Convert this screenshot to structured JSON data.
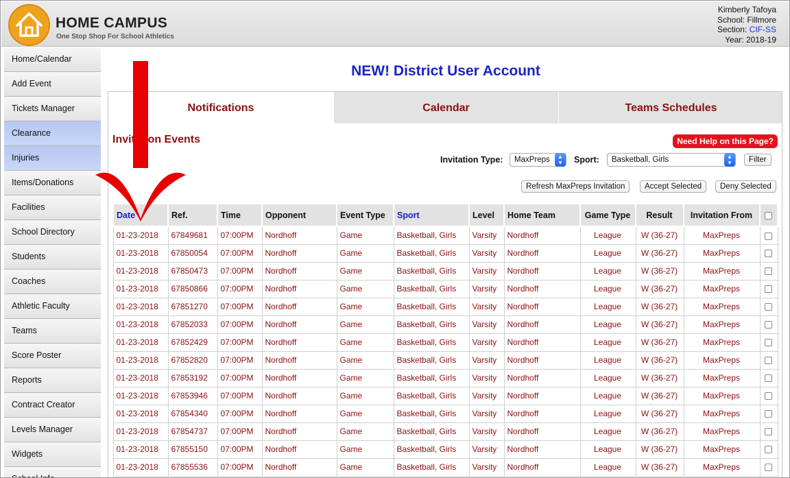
{
  "header": {
    "brand_title": "HOME CAMPUS",
    "brand_tagline": "One Stop Shop For School Athletics",
    "user": {
      "name": "Kimberly Tafoya",
      "school": "School: Fillmore",
      "section_label": "Section: ",
      "section_value": "CIF-SS",
      "year": "Year: 2018-19"
    }
  },
  "sidebar": {
    "items": [
      {
        "label": "Home/Calendar"
      },
      {
        "label": "Add Event"
      },
      {
        "label": "Tickets Manager"
      },
      {
        "label": "Clearance"
      },
      {
        "label": "Injuries"
      },
      {
        "label": "Items/Donations"
      },
      {
        "label": "Facilities"
      },
      {
        "label": "School Directory"
      },
      {
        "label": "Students"
      },
      {
        "label": "Coaches"
      },
      {
        "label": "Athletic Faculty"
      },
      {
        "label": "Teams"
      },
      {
        "label": "Score Poster"
      },
      {
        "label": "Reports"
      },
      {
        "label": "Contract Creator"
      },
      {
        "label": "Levels Manager"
      },
      {
        "label": "Widgets"
      },
      {
        "label": "School Info"
      }
    ]
  },
  "page_title": "NEW! District User Account",
  "tabs": [
    {
      "label": "Notifications"
    },
    {
      "label": "Calendar"
    },
    {
      "label": "Teams Schedules"
    }
  ],
  "section_title": "Invitation Events",
  "help_button": "Need Help on this Page?",
  "filters": {
    "invitation_type_label": "Invitation Type:",
    "invitation_type_value": "MaxPreps",
    "sport_label": "Sport:",
    "sport_value": "Basketball, Girls",
    "filter_button": "Filter"
  },
  "actions": {
    "refresh": "Refresh MaxPreps Invitation",
    "accept": "Accept Selected",
    "deny": "Deny Selected"
  },
  "table": {
    "columns": [
      "Date",
      "Ref.",
      "Time",
      "Opponent",
      "Event Type",
      "Sport",
      "Level",
      "Home Team",
      "Game Type",
      "Result",
      "Invitation From"
    ],
    "rows": [
      [
        "01-23-2018",
        "67849681",
        "07:00PM",
        "Nordhoff",
        "Game",
        "Basketball, Girls",
        "Varsity",
        "Nordhoff",
        "League",
        "W (36-27)",
        "MaxPreps"
      ],
      [
        "01-23-2018",
        "67850054",
        "07:00PM",
        "Nordhoff",
        "Game",
        "Basketball, Girls",
        "Varsity",
        "Nordhoff",
        "League",
        "W (36-27)",
        "MaxPreps"
      ],
      [
        "01-23-2018",
        "67850473",
        "07:00PM",
        "Nordhoff",
        "Game",
        "Basketball, Girls",
        "Varsity",
        "Nordhoff",
        "League",
        "W (36-27)",
        "MaxPreps"
      ],
      [
        "01-23-2018",
        "67850866",
        "07:00PM",
        "Nordhoff",
        "Game",
        "Basketball, Girls",
        "Varsity",
        "Nordhoff",
        "League",
        "W (36-27)",
        "MaxPreps"
      ],
      [
        "01-23-2018",
        "67851270",
        "07:00PM",
        "Nordhoff",
        "Game",
        "Basketball, Girls",
        "Varsity",
        "Nordhoff",
        "League",
        "W (36-27)",
        "MaxPreps"
      ],
      [
        "01-23-2018",
        "67852033",
        "07:00PM",
        "Nordhoff",
        "Game",
        "Basketball, Girls",
        "Varsity",
        "Nordhoff",
        "League",
        "W (36-27)",
        "MaxPreps"
      ],
      [
        "01-23-2018",
        "67852429",
        "07:00PM",
        "Nordhoff",
        "Game",
        "Basketball, Girls",
        "Varsity",
        "Nordhoff",
        "League",
        "W (36-27)",
        "MaxPreps"
      ],
      [
        "01-23-2018",
        "67852820",
        "07:00PM",
        "Nordhoff",
        "Game",
        "Basketball, Girls",
        "Varsity",
        "Nordhoff",
        "League",
        "W (36-27)",
        "MaxPreps"
      ],
      [
        "01-23-2018",
        "67853192",
        "07:00PM",
        "Nordhoff",
        "Game",
        "Basketball, Girls",
        "Varsity",
        "Nordhoff",
        "League",
        "W (36-27)",
        "MaxPreps"
      ],
      [
        "01-23-2018",
        "67853946",
        "07:00PM",
        "Nordhoff",
        "Game",
        "Basketball, Girls",
        "Varsity",
        "Nordhoff",
        "League",
        "W (36-27)",
        "MaxPreps"
      ],
      [
        "01-23-2018",
        "67854340",
        "07:00PM",
        "Nordhoff",
        "Game",
        "Basketball, Girls",
        "Varsity",
        "Nordhoff",
        "League",
        "W (36-27)",
        "MaxPreps"
      ],
      [
        "01-23-2018",
        "67854737",
        "07:00PM",
        "Nordhoff",
        "Game",
        "Basketball, Girls",
        "Varsity",
        "Nordhoff",
        "League",
        "W (36-27)",
        "MaxPreps"
      ],
      [
        "01-23-2018",
        "67855150",
        "07:00PM",
        "Nordhoff",
        "Game",
        "Basketball, Girls",
        "Varsity",
        "Nordhoff",
        "League",
        "W (36-27)",
        "MaxPreps"
      ],
      [
        "01-23-2018",
        "67855536",
        "07:00PM",
        "Nordhoff",
        "Game",
        "Basketball, Girls",
        "Varsity",
        "Nordhoff",
        "League",
        "W (36-27)",
        "MaxPreps"
      ]
    ]
  },
  "colors": {
    "brand_orange": "#f0a21e",
    "title_blue": "#1a22c9",
    "row_text": "#8b1010",
    "help_red": "#e3121f",
    "sidebar_active": "#b7c9f3",
    "annotation_arrow": "#e60000"
  }
}
